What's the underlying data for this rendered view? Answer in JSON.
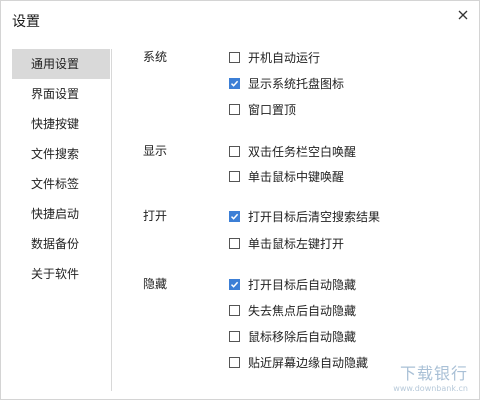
{
  "window": {
    "title": "设置",
    "close_icon": "close-icon"
  },
  "sidebar": {
    "items": [
      {
        "label": "通用设置",
        "active": true
      },
      {
        "label": "界面设置",
        "active": false
      },
      {
        "label": "快捷按键",
        "active": false
      },
      {
        "label": "文件搜索",
        "active": false
      },
      {
        "label": "文件标签",
        "active": false
      },
      {
        "label": "快捷启动",
        "active": false
      },
      {
        "label": "数据备份",
        "active": false
      },
      {
        "label": "关于软件",
        "active": false
      }
    ]
  },
  "sections": [
    {
      "label": "系统",
      "options": [
        {
          "label": "开机自动运行",
          "checked": false
        },
        {
          "label": "显示系统托盘图标",
          "checked": true
        },
        {
          "label": "窗口置顶",
          "checked": false
        }
      ]
    },
    {
      "label": "显示",
      "options": [
        {
          "label": "双击任务栏空白唤醒",
          "checked": false
        },
        {
          "label": "单击鼠标中键唤醒",
          "checked": false
        }
      ]
    },
    {
      "label": "打开",
      "options": [
        {
          "label": "打开目标后清空搜索结果",
          "checked": true
        },
        {
          "label": "单击鼠标左键打开",
          "checked": false
        }
      ]
    },
    {
      "label": "隐藏",
      "options": [
        {
          "label": "打开目标后自动隐藏",
          "checked": true
        },
        {
          "label": "失去焦点后自动隐藏",
          "checked": false
        },
        {
          "label": "鼠标移除后自动隐藏",
          "checked": false
        },
        {
          "label": "贴近屏幕边缘自动隐藏",
          "checked": false
        }
      ]
    }
  ],
  "watermark": {
    "main": "下载银行",
    "sub": "www.downbank.cn"
  },
  "colors": {
    "accent": "#3c7fd6",
    "sidebar_active": "#d9d9d9"
  }
}
